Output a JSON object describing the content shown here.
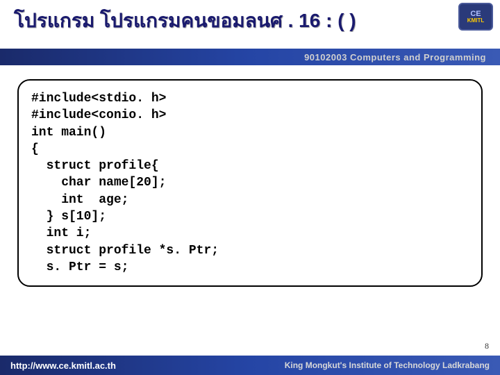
{
  "header": {
    "title": "โปรแกรม  โปรแกรมคนขอมลนศ . 16  : ( )"
  },
  "subheader": {
    "text": "90102003 Computers and Programming"
  },
  "logo": {
    "top": "CE",
    "bottom": "KMITL"
  },
  "code": {
    "lines": [
      "#include<stdio. h>",
      "#include<conio. h>",
      "int main()",
      "{",
      "  struct profile{",
      "    char name[20];",
      "    int  age;",
      "  } s[10];",
      "",
      "  int i;",
      "  struct profile *s. Ptr;",
      "",
      "  s. Ptr = s;"
    ]
  },
  "footer": {
    "url": "http://www.ce.kmitl.ac.th",
    "institute": "King Mongkut's Institute of Technology Ladkrabang"
  },
  "page_number": "8"
}
